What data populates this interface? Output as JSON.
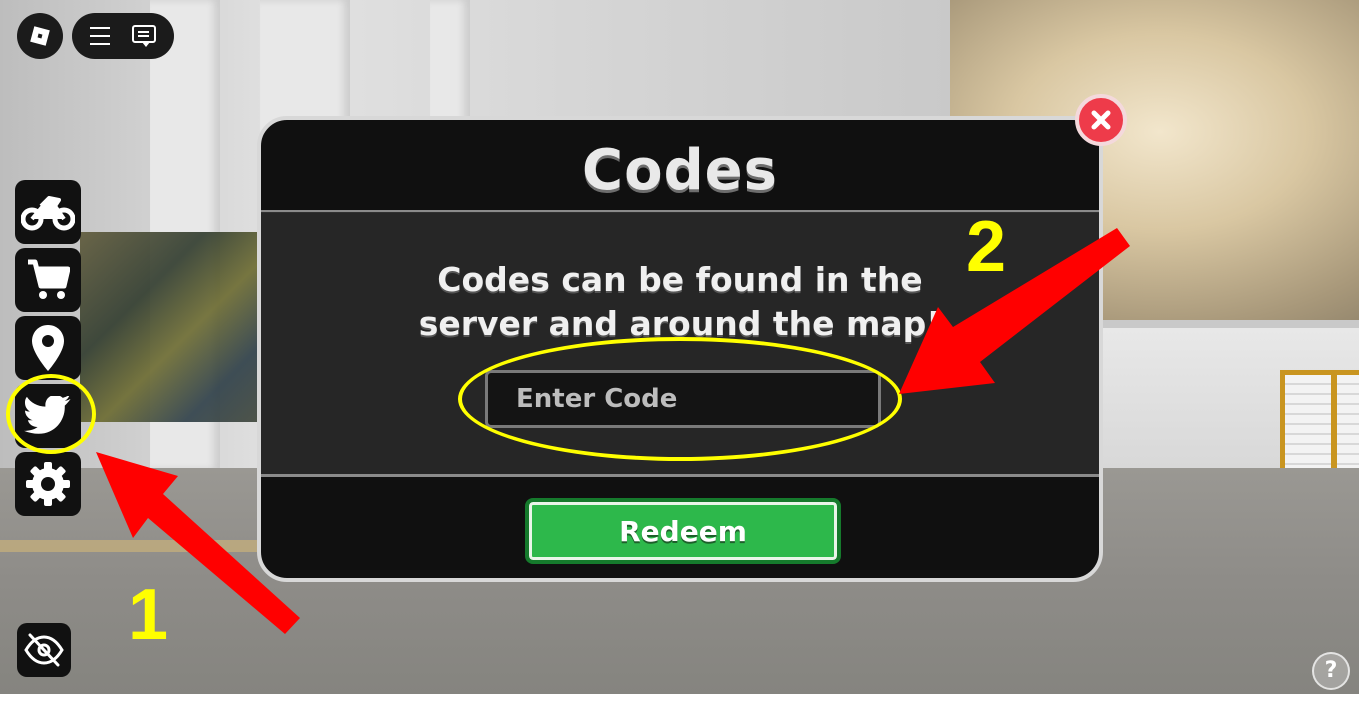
{
  "hud": {
    "roblox_menu": "roblox-logo-icon",
    "menu_icon": "hamburger-icon",
    "chat_icon": "chat-icon"
  },
  "side_menu": {
    "items": [
      {
        "name": "motorcycle-icon"
      },
      {
        "name": "shop-cart-icon"
      },
      {
        "name": "location-pin-icon"
      },
      {
        "name": "twitter-bird-icon"
      },
      {
        "name": "settings-gear-icon"
      }
    ]
  },
  "codes_dialog": {
    "title": "Codes",
    "description_line1": "Codes can be found in the",
    "description_line2": "server and around the map!",
    "input_placeholder": "Enter Code",
    "redeem_label": "Redeem",
    "close_icon": "close-x-icon"
  },
  "annotations": {
    "label_1": "1",
    "label_2": "2",
    "color": "#ffff00",
    "arrow_color": "#ff0000"
  },
  "help_label": "?",
  "colors": {
    "redeem_green": "#2db84b",
    "close_red": "#ee3b4a",
    "dialog_bg": "#101010"
  }
}
